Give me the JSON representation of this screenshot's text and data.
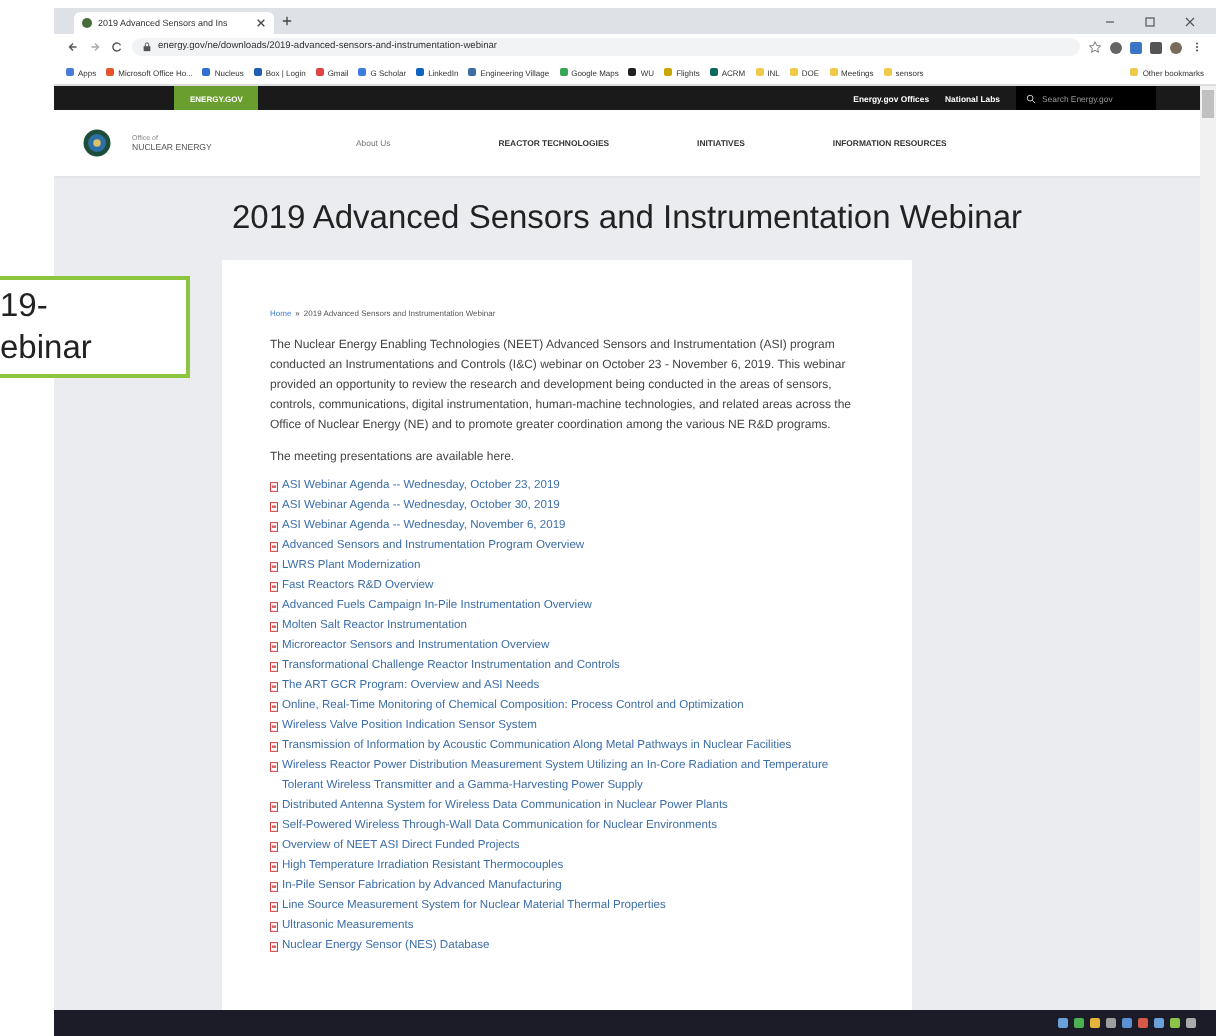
{
  "browser": {
    "tab_title": "2019 Advanced Sensors and Ins",
    "url": "energy.gov/ne/downloads/2019-advanced-sensors-and-instrumentation-webinar",
    "bookmarks": [
      "Apps",
      "Microsoft Office Ho...",
      "Nucleus",
      "Box | Login",
      "Gmail",
      "G Scholar",
      "LinkedIn",
      "Engineering Village",
      "Google Maps",
      "WU",
      "Flights",
      "ACRM",
      "INL",
      "DOE",
      "Meetings",
      "sensors"
    ],
    "other_bookmarks": "Other bookmarks"
  },
  "top_bar": {
    "logo": "ENERGY.GOV",
    "links": [
      "Energy.gov Offices",
      "National Labs"
    ],
    "search_placeholder": "Search Energy.gov"
  },
  "header": {
    "office_small": "Office of",
    "office_name": "NUCLEAR ENERGY",
    "nav": [
      "About Us",
      "REACTOR TECHNOLOGIES",
      "INITIATIVES",
      "INFORMATION RESOURCES"
    ]
  },
  "page_title": "2019 Advanced Sensors and Instrumentation Webinar",
  "breadcrumb": {
    "home": "Home",
    "separator": "»",
    "current": "2019 Advanced Sensors and Instrumentation Webinar"
  },
  "intro": "The Nuclear Energy Enabling Technologies (NEET) Advanced Sensors and Instrumentation (ASI) program conducted an Instrumentations and Controls (I&C) webinar on October 23 - November 6, 2019. This webinar provided an opportunity to review the research and development being conducted in the areas of sensors, controls, communications, digital instrumentation, human-machine technologies, and related areas across the Office of Nuclear Energy (NE) and to promote greater coordination among the various NE R&D programs.",
  "note": "The meeting presentations are available here.",
  "documents": [
    "ASI Webinar Agenda -- Wednesday, October 23, 2019",
    "ASI Webinar Agenda -- Wednesday, October 30, 2019",
    "ASI Webinar Agenda -- Wednesday, November 6, 2019",
    "Advanced Sensors and Instrumentation Program Overview",
    "LWRS Plant Modernization",
    "Fast Reactors R&D Overview",
    "Advanced Fuels Campaign In-Pile Instrumentation Overview",
    "Molten Salt Reactor Instrumentation",
    "Microreactor Sensors and Instrumentation Overview",
    "Transformational Challenge Reactor Instrumentation and Controls",
    "The ART GCR Program: Overview and ASI Needs",
    "Online, Real-Time Monitoring of Chemical Composition: Process Control and Optimization",
    "Wireless Valve Position Indication Sensor System",
    "Transmission of Information by Acoustic Communication Along Metal Pathways in Nuclear Facilities",
    "Wireless Reactor Power Distribution Measurement System Utilizing an In-Core Radiation and Temperature Tolerant Wireless Transmitter and a Gamma-Harvesting Power Supply",
    "Distributed Antenna System for Wireless Data Communication in Nuclear Power Plants",
    "Self-Powered Wireless Through-Wall Data Communication for Nuclear Environments",
    "Overview of NEET ASI Direct Funded Projects",
    "High Temperature Irradiation Resistant Thermocouples",
    "In-Pile Sensor Fabrication by Advanced Manufacturing",
    "Line Source Measurement System for Nuclear Material Thermal Properties",
    "Ultrasonic Measurements",
    "Nuclear Energy Sensor (NES) Database"
  ],
  "callout": {
    "lines": [
      "19-",
      "ebinar"
    ]
  }
}
